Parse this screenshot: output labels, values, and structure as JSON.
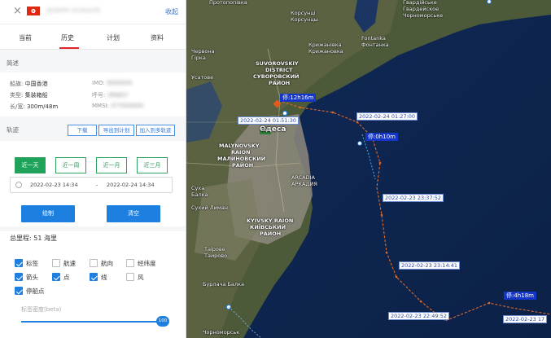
{
  "header": {
    "close": "×",
    "vessel_name": "JOSEPH SCHULTE",
    "collapse": "收起"
  },
  "tabs": [
    {
      "label": "当前"
    },
    {
      "label": "历史"
    },
    {
      "label": "计划"
    },
    {
      "label": "资料"
    }
  ],
  "overview": {
    "title": "简述",
    "flag_label": "船旗:",
    "flag_value": "中国香港",
    "type_label": "类型:",
    "type_value": "集装箱船",
    "size_label": "长/宽:",
    "size_value": "300m/48m",
    "imo_label": "IMO:",
    "imo_value": "9000000",
    "callsign_label": "呼号:",
    "callsign_value": "VRWD7",
    "mmsi_label": "MMSI:",
    "mmsi_value": "477000000"
  },
  "track": {
    "title": "轨迹",
    "download": "下载",
    "export_plan": "导出到计划",
    "add_multi": "加入到多轨迹",
    "ranges": [
      "近一天",
      "近一周",
      "近一月",
      "近三月"
    ],
    "start": "2022-02-23 14:34",
    "dash": "-",
    "end": "2022-02-24 14:34",
    "draw": "绘制",
    "clear": "清空",
    "distance": "总里程: 51 海里"
  },
  "options": [
    {
      "label": "标签",
      "on": true
    },
    {
      "label": "航速",
      "on": false
    },
    {
      "label": "航向",
      "on": false
    },
    {
      "label": "经纬度",
      "on": false
    },
    {
      "label": "箭头",
      "on": true
    },
    {
      "label": "点",
      "on": true
    },
    {
      "label": "线",
      "on": true
    },
    {
      "label": "风",
      "on": false
    },
    {
      "label": "停船点",
      "on": true
    }
  ],
  "density": {
    "label": "标签密度(beta)",
    "value": "100",
    "fraction": 1.0
  },
  "map": {
    "places": [
      "Протопопівка",
      "Корсунці",
      "Корсунцы",
      "Гвардійське",
      "Гвардейское",
      "Чорноморське",
      "Fontanka",
      "Крижанівка",
      "Фонтанка",
      "Крижановка",
      "SUVOROVSKIY",
      "DISTRICT",
      "СУВОРОВСКИЙ",
      "РАЙОН",
      "MALYNOVSKY",
      "RAION",
      "МАЛИНОВСКИЙ",
      "РАЙОН",
      "Одеса",
      "ARCADIA",
      "АРКАДИЯ",
      "KYIVSKY RAION",
      "КИЇВСЬКИЙ",
      "РАЙОН",
      "Таїрове",
      "Таирово",
      "Бурлача Балка",
      "Чорноморськ",
      "Червона",
      "Гірка",
      "Усатове",
      "Суха",
      "Балка",
      "Сухий Лиман",
      "E95"
    ],
    "stops": [
      "停:12h16m",
      "停:0h10m",
      "停:4h18m"
    ],
    "times": [
      "2022-02-24 01:51:30",
      "2022-02-24 01:27:00",
      "2022-02-23 23:37:52",
      "2022-02-23 23:14:41",
      "2022-02-23 22:49:52",
      "2022-02-23 17"
    ]
  },
  "colors": {
    "accent": "#1d7fe0",
    "green": "#1fa35a",
    "track": "#e06a2a",
    "stop": "#1336c8",
    "tab_active": "#e0252a"
  }
}
